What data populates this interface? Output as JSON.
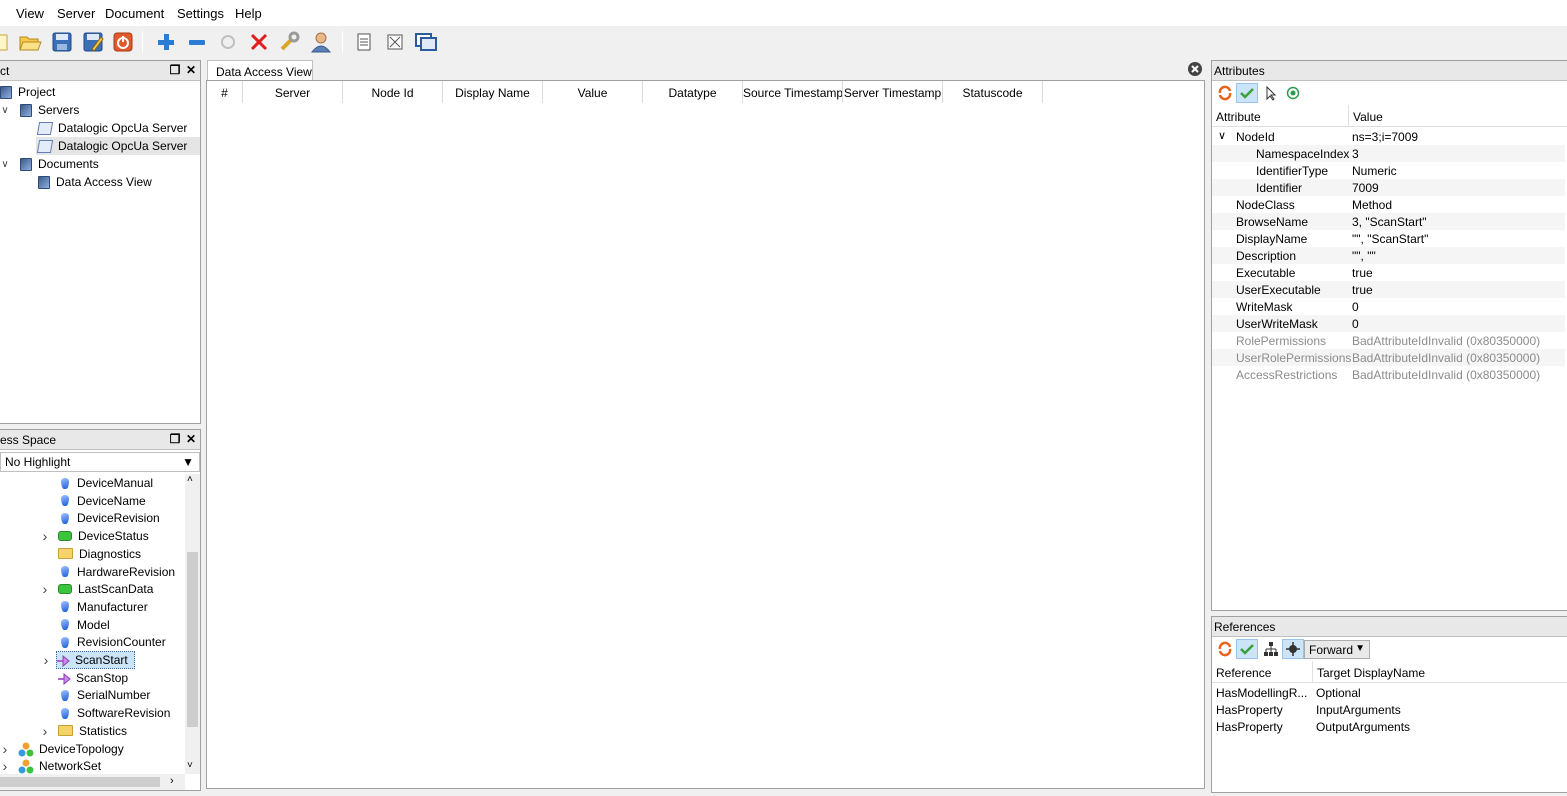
{
  "menu": [
    "View",
    "Server",
    "Document",
    "Settings",
    "Help"
  ],
  "project_panel": {
    "title": "ct",
    "tree": [
      {
        "label": "Project",
        "indent": 0,
        "chevron": "",
        "icon": "book"
      },
      {
        "label": "Servers",
        "indent": 1,
        "chevron": "v",
        "icon": "book"
      },
      {
        "label": "Datalogic OpcUa Server",
        "indent": 2,
        "chevron": "",
        "icon": "server"
      },
      {
        "label": "Datalogic OpcUa Server",
        "indent": 2,
        "chevron": "",
        "icon": "server",
        "selected": true
      },
      {
        "label": "Documents",
        "indent": 1,
        "chevron": "v",
        "icon": "book"
      },
      {
        "label": "Data Access View",
        "indent": 2,
        "chevron": "",
        "icon": "book"
      }
    ]
  },
  "address_panel": {
    "title": "ess Space",
    "highlight_select": "No Highlight",
    "tree": [
      {
        "label": "DeviceManual",
        "chevron": "",
        "icon": "var"
      },
      {
        "label": "DeviceName",
        "chevron": "",
        "icon": "var"
      },
      {
        "label": "DeviceRevision",
        "chevron": "",
        "icon": "var"
      },
      {
        "label": "DeviceStatus",
        "chevron": ">",
        "icon": "obj"
      },
      {
        "label": "Diagnostics",
        "chevron": "",
        "icon": "folder"
      },
      {
        "label": "HardwareRevision",
        "chevron": "",
        "icon": "var"
      },
      {
        "label": "LastScanData",
        "chevron": ">",
        "icon": "obj"
      },
      {
        "label": "Manufacturer",
        "chevron": "",
        "icon": "var"
      },
      {
        "label": "Model",
        "chevron": "",
        "icon": "var"
      },
      {
        "label": "RevisionCounter",
        "chevron": "",
        "icon": "var"
      },
      {
        "label": "ScanStart",
        "chevron": ">",
        "icon": "method",
        "focused": true
      },
      {
        "label": "ScanStop",
        "chevron": "",
        "icon": "method"
      },
      {
        "label": "SerialNumber",
        "chevron": "",
        "icon": "var"
      },
      {
        "label": "SoftwareRevision",
        "chevron": "",
        "icon": "var"
      },
      {
        "label": "Statistics",
        "chevron": ">",
        "icon": "folder"
      },
      {
        "label": "DeviceTopology",
        "chevron": ">",
        "icon": "topo",
        "outer": true
      },
      {
        "label": "NetworkSet",
        "chevron": ">",
        "icon": "topo",
        "outer": true
      }
    ]
  },
  "data_access": {
    "tab": "Data Access View",
    "columns": [
      "#",
      "Server",
      "Node Id",
      "Display Name",
      "Value",
      "Datatype",
      "Source Timestamp",
      "Server Timestamp",
      "Statuscode"
    ]
  },
  "attributes": {
    "title": "Attributes",
    "col_attribute": "Attribute",
    "col_value": "Value",
    "rows": [
      {
        "name": "NodeId",
        "value": "ns=3;i=7009",
        "level": 0,
        "chevron": "v",
        "dim": false
      },
      {
        "name": "NamespaceIndex",
        "value": "3",
        "level": 1,
        "dim": false
      },
      {
        "name": "IdentifierType",
        "value": "Numeric",
        "level": 1,
        "dim": false
      },
      {
        "name": "Identifier",
        "value": "7009",
        "level": 1,
        "dim": false
      },
      {
        "name": "NodeClass",
        "value": "Method",
        "level": 0,
        "dim": false
      },
      {
        "name": "BrowseName",
        "value": "3, \"ScanStart\"",
        "level": 0,
        "dim": false
      },
      {
        "name": "DisplayName",
        "value": "\"\", \"ScanStart\"",
        "level": 0,
        "dim": false
      },
      {
        "name": "Description",
        "value": "\"\", \"\"",
        "level": 0,
        "dim": false
      },
      {
        "name": "Executable",
        "value": "true",
        "level": 0,
        "dim": false
      },
      {
        "name": "UserExecutable",
        "value": "true",
        "level": 0,
        "dim": false
      },
      {
        "name": "WriteMask",
        "value": "0",
        "level": 0,
        "dim": false
      },
      {
        "name": "UserWriteMask",
        "value": "0",
        "level": 0,
        "dim": false
      },
      {
        "name": "RolePermissions",
        "value": "BadAttributeIdInvalid (0x80350000)",
        "level": 0,
        "dim": true
      },
      {
        "name": "UserRolePermissions",
        "value": "BadAttributeIdInvalid (0x80350000)",
        "level": 0,
        "dim": true
      },
      {
        "name": "AccessRestrictions",
        "value": "BadAttributeIdInvalid (0x80350000)",
        "level": 0,
        "dim": true
      }
    ]
  },
  "references": {
    "title": "References",
    "direction": "Forward",
    "col_reference": "Reference",
    "col_target": "Target DisplayName",
    "rows": [
      {
        "reference": "HasModellingR...",
        "target": "Optional"
      },
      {
        "reference": "HasProperty",
        "target": "InputArguments"
      },
      {
        "reference": "HasProperty",
        "target": "OutputArguments"
      }
    ]
  },
  "colors": {
    "selection": "#cce4f7",
    "panel_header": "#e8e8e8",
    "dim_text": "#8c8c8c"
  }
}
